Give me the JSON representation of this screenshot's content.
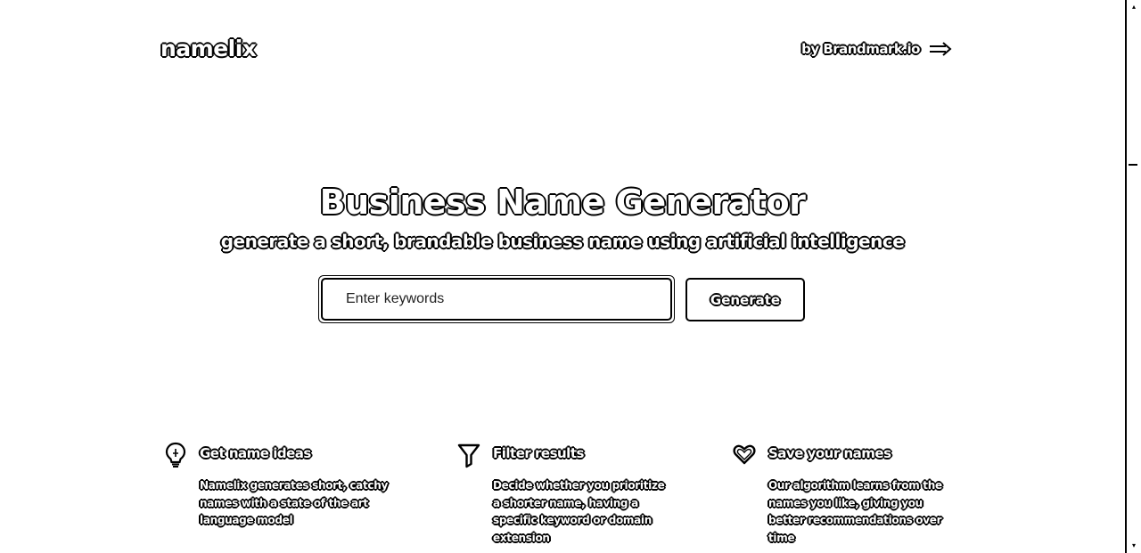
{
  "header": {
    "logo": "namelix",
    "byline": "by Brandmark.io",
    "byline_icon": "arrow-right-icon"
  },
  "hero": {
    "title": "Business Name Generator",
    "subtitle": "generate a short, brandable business name using artificial intelligence"
  },
  "search": {
    "placeholder": "Enter keywords",
    "value": "",
    "button_label": "Generate"
  },
  "features": [
    {
      "icon": "lightbulb-icon",
      "title": "Get name ideas",
      "description": "Namelix generates short, catchy names with a state of the art language model"
    },
    {
      "icon": "filter-icon",
      "title": "Filter results",
      "description": "Decide whether you prioritize a shorter name, having a specific keyword or domain extension"
    },
    {
      "icon": "heart-icon",
      "title": "Save your names",
      "description": "Our algorithm learns from the names you like, giving you better recommendations over time"
    }
  ],
  "colors": {
    "background": "#ffffff",
    "ink": "#000000"
  }
}
